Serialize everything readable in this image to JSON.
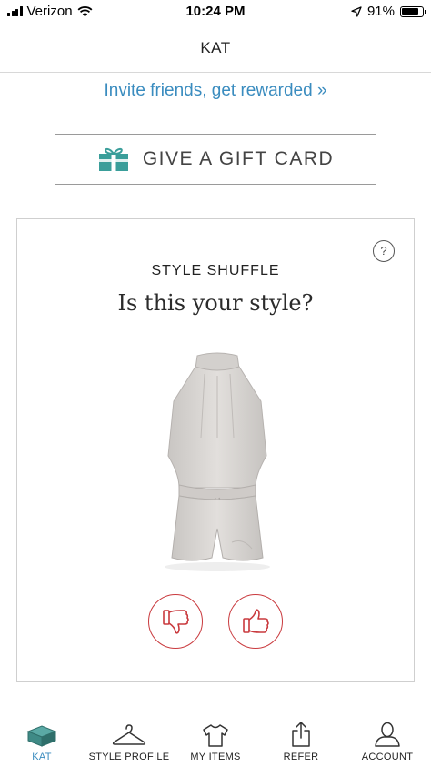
{
  "status_bar": {
    "carrier": "Verizon",
    "time": "10:24 PM",
    "battery_percent": "91%",
    "battery_level": 0.91
  },
  "header": {
    "title": "KAT"
  },
  "invite": {
    "label": "Invite friends, get rewarded »"
  },
  "gift_card": {
    "label": "GIVE A GIFT CARD",
    "icon": "gift-icon",
    "accent_color": "#3a9e9a"
  },
  "style_shuffle": {
    "heading": "STYLE SHUFFLE",
    "question": "Is this your style?",
    "help_label": "?",
    "product": "light grey halter romper",
    "vote_color": "#c9393d"
  },
  "tabs": [
    {
      "label": "KAT",
      "icon": "box-icon",
      "active": true
    },
    {
      "label": "STYLE PROFILE",
      "icon": "hanger-icon",
      "active": false
    },
    {
      "label": "MY ITEMS",
      "icon": "shirt-icon",
      "active": false
    },
    {
      "label": "REFER",
      "icon": "share-icon",
      "active": false
    },
    {
      "label": "ACCOUNT",
      "icon": "person-icon",
      "active": false
    }
  ],
  "colors": {
    "link": "#3a8cbf",
    "active_tab": "#3a8cbf"
  }
}
